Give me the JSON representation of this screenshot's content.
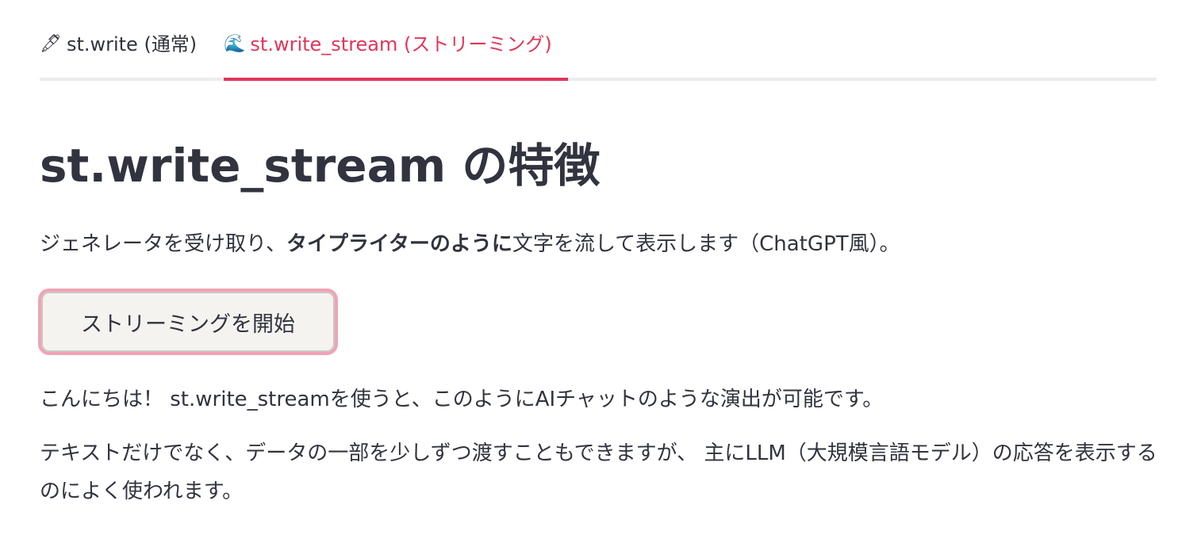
{
  "tabs": [
    {
      "icon": "🖋",
      "label": "st.write (通常)",
      "active": false
    },
    {
      "icon": "🌊",
      "label": "st.write_stream (ストリーミング)",
      "active": true
    }
  ],
  "colors": {
    "accent": "#e0365a",
    "text": "#31333f",
    "button_bg": "#f4f3ef",
    "button_focus_ring": "#f0a3b5"
  },
  "main": {
    "title": "st.write_stream の特徴",
    "intro": {
      "prefix": "ジェネレータを受け取り、",
      "bold": "タイプライターのように",
      "suffix": "文字を流して表示します（ChatGPT風）。"
    },
    "start_button_label": "ストリーミングを開始",
    "stream_paragraphs": [
      "こんにちは！ st.write_streamを使うと、このようにAIチャットのような演出が可能です。",
      "テキストだけでなく、データの一部を少しずつ渡すこともできますが、 主にLLM（大規模言語モデル）の応答を表示するのによく使われます。"
    ]
  }
}
